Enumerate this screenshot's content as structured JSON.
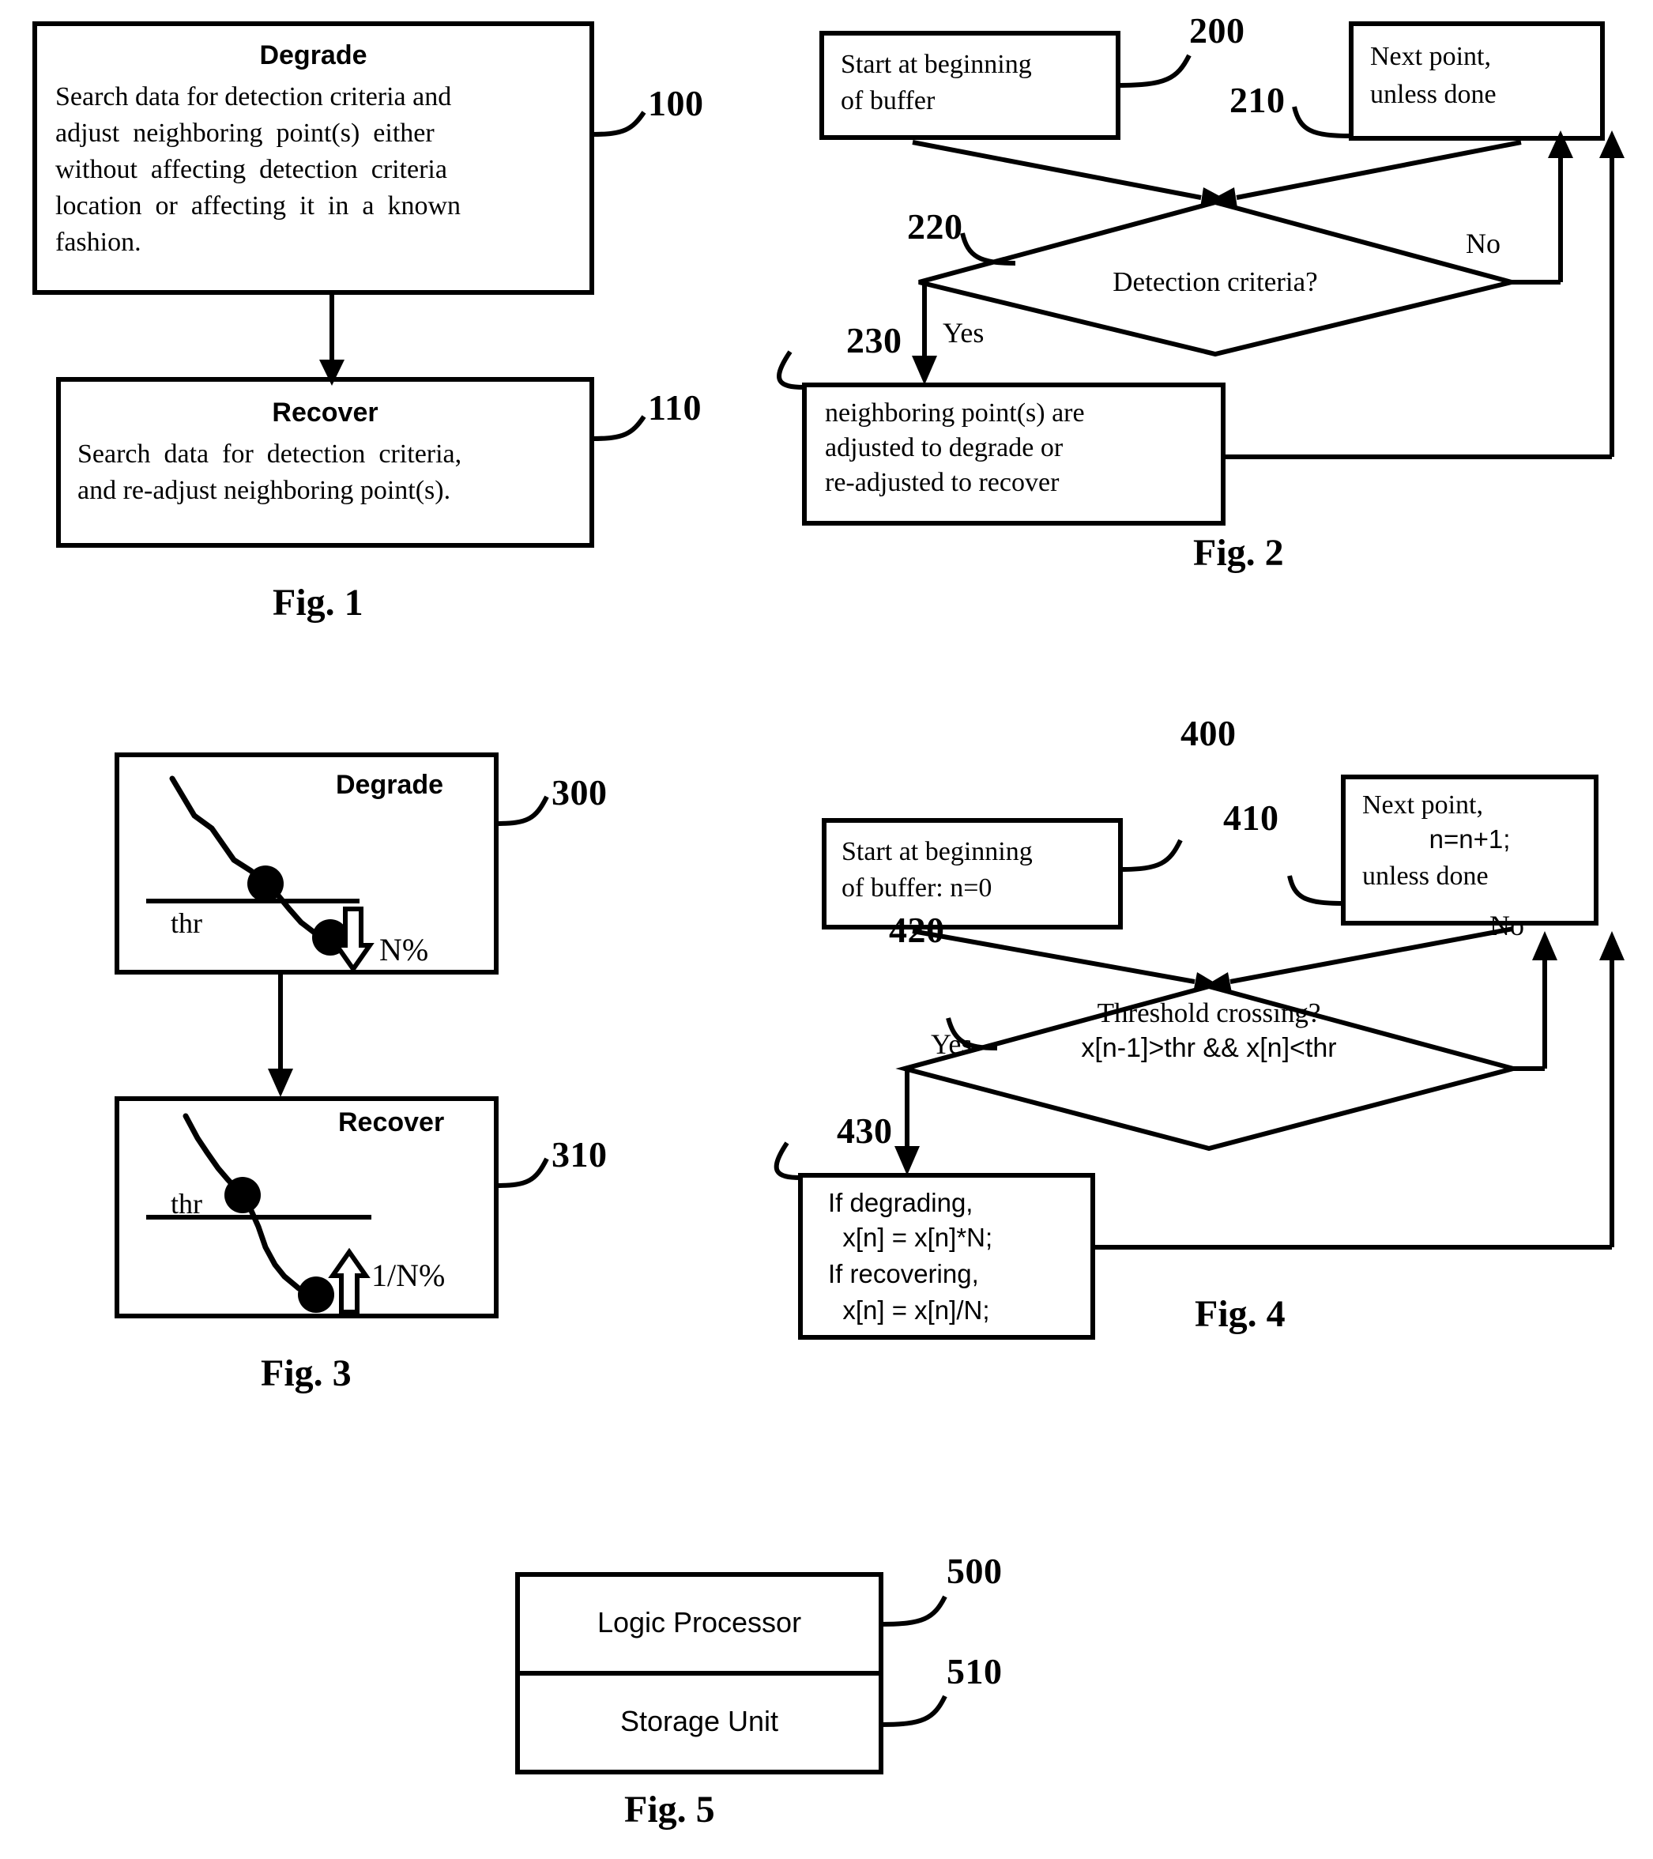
{
  "document": {
    "kind": "patent-drawing-sheet",
    "figures": [
      "Fig. 1",
      "Fig. 2",
      "Fig. 3",
      "Fig. 4",
      "Fig. 5"
    ]
  },
  "fig1": {
    "label": "Fig. 1",
    "degrade": {
      "title": "Degrade",
      "line1": "Search data for detection criteria and",
      "line2": "adjust  neighboring  point(s)  either",
      "line3": "without  affecting  detection  criteria",
      "line4": "location  or  affecting  it  in  a  known",
      "line5": "fashion.",
      "ref": "100"
    },
    "recover": {
      "title": "Recover",
      "line1": "Search  data  for  detection  criteria,",
      "line2": "and re-adjust neighboring point(s).",
      "ref": "110"
    }
  },
  "fig2": {
    "label": "Fig. 2",
    "start": {
      "line1": "Start at beginning",
      "line2": "of buffer",
      "ref": "200"
    },
    "next": {
      "line1": "Next point,",
      "line2": "unless done",
      "ref": "210"
    },
    "decision": {
      "text": "Detection criteria?",
      "ref": "220",
      "yes": "Yes",
      "no": "No"
    },
    "action": {
      "line1": "neighboring point(s) are",
      "line2": "adjusted to degrade or",
      "line3": "re-adjusted to recover",
      "ref": "230"
    }
  },
  "fig3": {
    "label": "Fig. 3",
    "degrade": {
      "title": "Degrade",
      "thr": "thr",
      "arrow_label": "N%",
      "ref": "300"
    },
    "recover": {
      "title": "Recover",
      "thr": "thr",
      "arrow_label": "1/N%",
      "ref": "310"
    }
  },
  "fig4": {
    "label": "Fig. 4",
    "start": {
      "line1": "Start at beginning",
      "line2": "of buffer: n=0",
      "ref": "400"
    },
    "next": {
      "line1": "Next point,",
      "line2": "n=n+1;",
      "line3": "unless done",
      "ref": "410"
    },
    "decision": {
      "line1": "Threshold crossing?",
      "line2": "x[n-1]>thr && x[n]<thr",
      "ref": "420",
      "yes": "Yes",
      "no": "No"
    },
    "action": {
      "line1": "If degrading,",
      "line2": "  x[n] = x[n]*N;",
      "line3": "If recovering,",
      "line4": "  x[n] = x[n]/N;",
      "ref": "430"
    }
  },
  "fig5": {
    "label": "Fig. 5",
    "logic_processor": {
      "text": "Logic Processor",
      "ref": "500"
    },
    "storage_unit": {
      "text": "Storage Unit",
      "ref": "510"
    }
  },
  "colors": {
    "ink": "#000000",
    "paper": "#ffffff"
  }
}
